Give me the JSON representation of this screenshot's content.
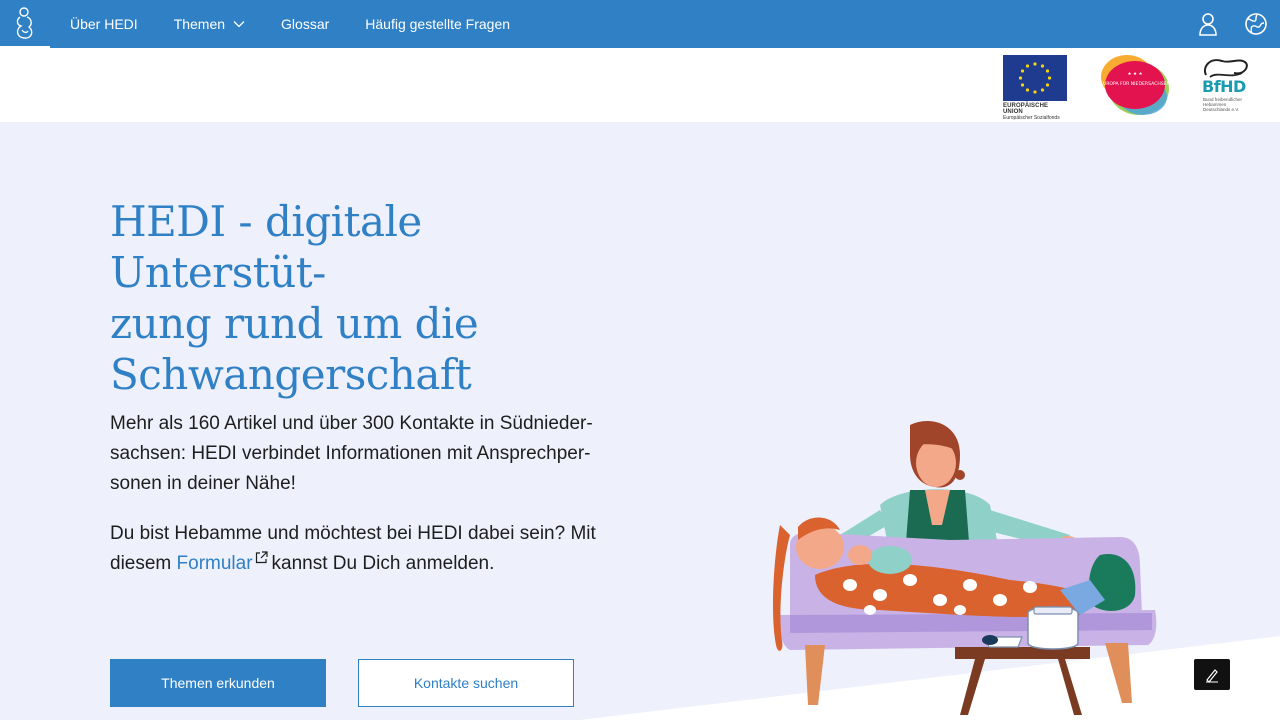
{
  "nav": {
    "items": [
      {
        "label": "Über HEDI"
      },
      {
        "label": "Themen"
      },
      {
        "label": "Glossar"
      },
      {
        "label": "Häufig gestellte Fragen"
      }
    ]
  },
  "sponsors": {
    "eu_line1": "EUROPÄISCHE UNION",
    "eu_line2": "Europäischer Sozialfonds",
    "nds_text": "EUROPA FÜR NIEDERSACHSEN",
    "bfhd_title": "BfHD",
    "bfhd_sub": "Bund freiberuflicher Hebammen Deutschlands e.V."
  },
  "hero": {
    "title": "HEDI - digitale Unterstüt-\nzung rund um die\nSchwangerschaft",
    "p1": "Mehr als 160 Artikel und über 300 Kontakte in Südnieder-\nsachsen: HEDI verbindet Informationen mit Ansprechper-\nsonen in deiner Nähe!",
    "p2_before": "Du bist Hebamme und möchtest bei HEDI dabei sein? Mit\ndiesem ",
    "p2_link": "Formular",
    "p2_after": "kannst Du Dich anmelden."
  },
  "buttons": {
    "primary": "Themen erkunden",
    "secondary": "Kontakte suchen"
  },
  "colors": {
    "brand_blue": "#2f80c5",
    "hero_background": "#eef0fb"
  }
}
